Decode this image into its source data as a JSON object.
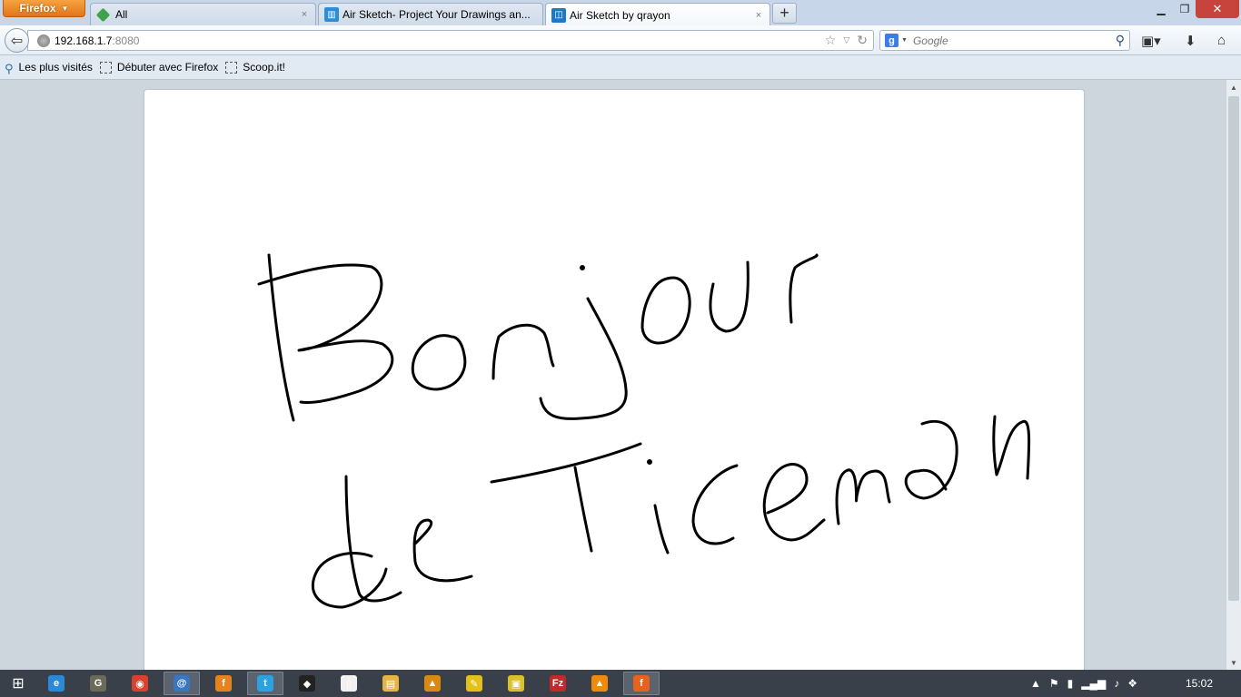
{
  "browser": {
    "menu_label": "Firefox",
    "tabs": [
      {
        "title": "All",
        "icon": "feedly-icon",
        "color": "#3fa34d"
      },
      {
        "title": "Air Sketch- Project Your Drawings an...",
        "icon": "airsketch-icon",
        "color": "#2a8fd8"
      },
      {
        "title": "Air Sketch by qrayon",
        "icon": "qrayon-icon",
        "color": "#1f77c9"
      }
    ],
    "close_glyph": "×",
    "new_tab_glyph": "+"
  },
  "navbar": {
    "url_host": "192.168.1.7",
    "url_port": ":8080",
    "search_placeholder": "Google"
  },
  "bookmarks": [
    {
      "label": "Les plus visités",
      "icon": "most-visited-icon"
    },
    {
      "label": "Débuter avec Firefox",
      "icon": "bookmark-icon"
    },
    {
      "label": "Scoop.it!",
      "icon": "bookmark-icon"
    }
  ],
  "drawing": {
    "description_lines": [
      "Bonjour",
      "de Ticeman"
    ],
    "stroke_color": "#000000"
  },
  "taskbar": {
    "apps": [
      {
        "name": "ie-icon",
        "glyph": "e",
        "color": "#2b8ad8",
        "active": false
      },
      {
        "name": "gimp-icon",
        "glyph": "G",
        "color": "#6b6b5a",
        "active": false
      },
      {
        "name": "chrome-icon",
        "glyph": "◉",
        "color": "#d9412e",
        "active": false
      },
      {
        "name": "thunderbird-icon",
        "glyph": "@",
        "color": "#3a76c2",
        "active": true
      },
      {
        "name": "firefox-taskbar-icon",
        "glyph": "f",
        "color": "#e8821d",
        "active": false
      },
      {
        "name": "twitter-icon",
        "glyph": "t",
        "color": "#2aa3e0",
        "active": true
      },
      {
        "name": "inkscape-icon",
        "glyph": "◆",
        "color": "#222",
        "active": false
      },
      {
        "name": "file-icon",
        "glyph": "▯",
        "color": "#f1f1f1",
        "active": false
      },
      {
        "name": "explorer-icon",
        "glyph": "▤",
        "color": "#e2b640",
        "active": false
      },
      {
        "name": "vpn-icon",
        "glyph": "▲",
        "color": "#d88a12",
        "active": false
      },
      {
        "name": "pen-tool-icon",
        "glyph": "✎",
        "color": "#e3c11a",
        "active": false
      },
      {
        "name": "archive-icon",
        "glyph": "▣",
        "color": "#d9c128",
        "active": false
      },
      {
        "name": "filezilla-icon",
        "glyph": "Fz",
        "color": "#bf2a2a",
        "active": false
      },
      {
        "name": "vlc-icon",
        "glyph": "▲",
        "color": "#ef8a0c",
        "active": false
      },
      {
        "name": "firefox-active-icon",
        "glyph": "f",
        "color": "#e8621d",
        "active": true
      }
    ],
    "clock": "15:02"
  }
}
